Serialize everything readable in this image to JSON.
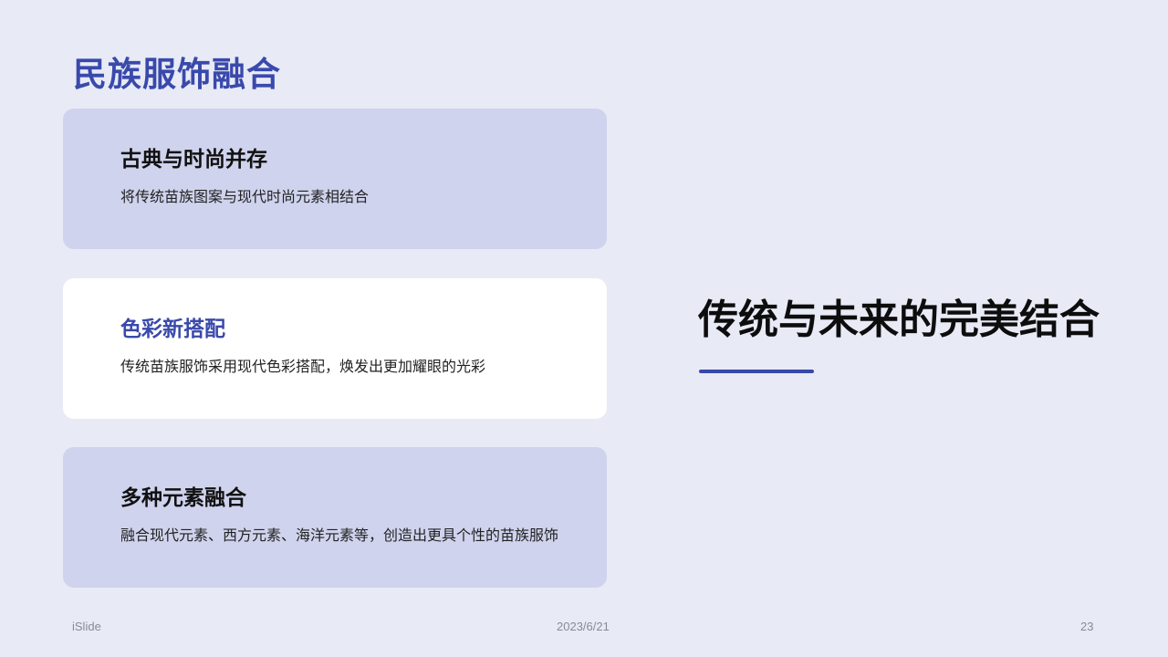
{
  "slide": {
    "title": "民族服饰融合",
    "cards": [
      {
        "heading": "古典与时尚并存",
        "body": "将传统苗族图案与现代时尚元素相结合"
      },
      {
        "heading": "色彩新搭配",
        "body": "传统苗族服饰采用现代色彩搭配，焕发出更加耀眼的光彩"
      },
      {
        "heading": "多种元素融合",
        "body": "融合现代元素、西方元素、海洋元素等，创造出更具个性的苗族服饰"
      }
    ],
    "hero_title": "传统与未来的完美结合"
  },
  "footer": {
    "brand": "iSlide",
    "date": "2023/6/21",
    "page_number": "23"
  },
  "colors": {
    "background": "#e8eaf6",
    "accent": "#3949ab",
    "card_muted": "#cfd3ed",
    "card_highlight": "#ffffff"
  }
}
